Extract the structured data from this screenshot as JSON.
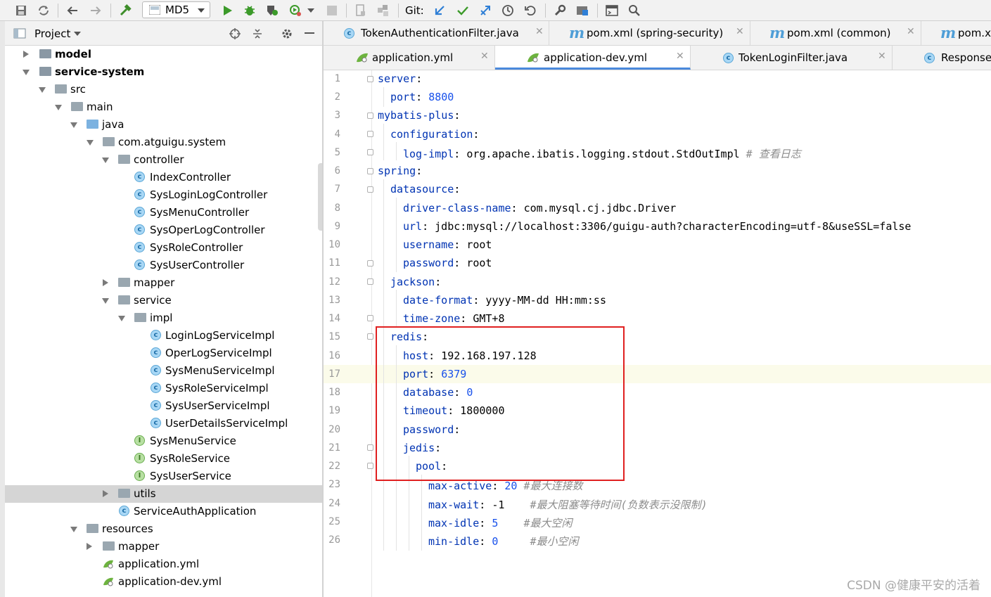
{
  "toolbar": {
    "run_config": "MD5",
    "git_label": "Git:"
  },
  "project_panel": {
    "title": "Project"
  },
  "tree": [
    {
      "label": "model",
      "bold": true
    },
    {
      "label": "service-system",
      "bold": true
    },
    {
      "label": "src"
    },
    {
      "label": "main"
    },
    {
      "label": "java"
    },
    {
      "label": "com.atguigu.system"
    },
    {
      "label": "controller"
    },
    {
      "label": "IndexController"
    },
    {
      "label": "SysLoginLogController"
    },
    {
      "label": "SysMenuController"
    },
    {
      "label": "SysOperLogController"
    },
    {
      "label": "SysRoleController"
    },
    {
      "label": "SysUserController"
    },
    {
      "label": "mapper"
    },
    {
      "label": "service"
    },
    {
      "label": "impl"
    },
    {
      "label": "LoginLogServiceImpl"
    },
    {
      "label": "OperLogServiceImpl"
    },
    {
      "label": "SysMenuServiceImpl"
    },
    {
      "label": "SysRoleServiceImpl"
    },
    {
      "label": "SysUserServiceImpl"
    },
    {
      "label": "UserDetailsServiceImpl"
    },
    {
      "label": "SysMenuService"
    },
    {
      "label": "SysRoleService"
    },
    {
      "label": "SysUserService"
    },
    {
      "label": "utils"
    },
    {
      "label": "ServiceAuthApplication"
    },
    {
      "label": "resources"
    },
    {
      "label": "mapper"
    },
    {
      "label": "application.yml"
    },
    {
      "label": "application-dev.yml"
    }
  ],
  "tabs_row1": [
    {
      "label": "TokenAuthenticationFilter.java"
    },
    {
      "label": "pom.xml (spring-security)"
    },
    {
      "label": "pom.xml (common)"
    },
    {
      "label": "pom.x"
    }
  ],
  "tabs_row2": [
    {
      "label": "application.yml"
    },
    {
      "label": "application-dev.yml"
    },
    {
      "label": "TokenLoginFilter.java"
    },
    {
      "label": "Response"
    }
  ],
  "code": {
    "l1_key": "server",
    "l2_key": "port",
    "l2_val": "8800",
    "l3_key": "mybatis-plus",
    "l4_key": "configuration",
    "l5_key": "log-impl",
    "l5_val": "org.apache.ibatis.logging.stdout.StdOutImpl",
    "l5_cmt": "# 查看日志",
    "l6_key": "spring",
    "l7_key": "datasource",
    "l8_key": "driver-class-name",
    "l8_val": "com.mysql.cj.jdbc.Driver",
    "l9_key": "url",
    "l9_val": "jdbc:mysql://localhost:3306/guigu-auth?characterEncoding=utf-8&useSSL=false",
    "l10_key": "username",
    "l10_val": "root",
    "l11_key": "password",
    "l11_val": "root",
    "l12_key": "jackson",
    "l13_key": "date-format",
    "l13_val": "yyyy-MM-dd HH:mm:ss",
    "l14_key": "time-zone",
    "l14_val": "GMT+8",
    "l15_key": "redis",
    "l16_key": "host",
    "l16_val": "192.168.197.128",
    "l17_key": "port",
    "l17_val": "6379",
    "l18_key": "database",
    "l18_val": "0",
    "l19_key": "timeout",
    "l19_val": "1800000",
    "l20_key": "password",
    "l21_key": "jedis",
    "l22_key": "pool",
    "l23_key": "max-active",
    "l23_val": "20",
    "l23_cmt": "#最大连接数",
    "l24_key": "max-wait",
    "l24_val": "-1",
    "l24_cmt": "#最大阻塞等待时间(负数表示没限制)",
    "l25_key": "max-idle",
    "l25_val": "5",
    "l25_cmt": "#最大空闲",
    "l26_key": "min-idle",
    "l26_val": "0",
    "l26_cmt": "#最小空闲"
  },
  "line_numbers": [
    "1",
    "2",
    "3",
    "4",
    "5",
    "6",
    "7",
    "8",
    "9",
    "10",
    "11",
    "12",
    "13",
    "14",
    "15",
    "16",
    "17",
    "18",
    "19",
    "20",
    "21",
    "22",
    "23",
    "24",
    "25",
    "26"
  ],
  "watermark": "CSDN @健康平安的活着"
}
